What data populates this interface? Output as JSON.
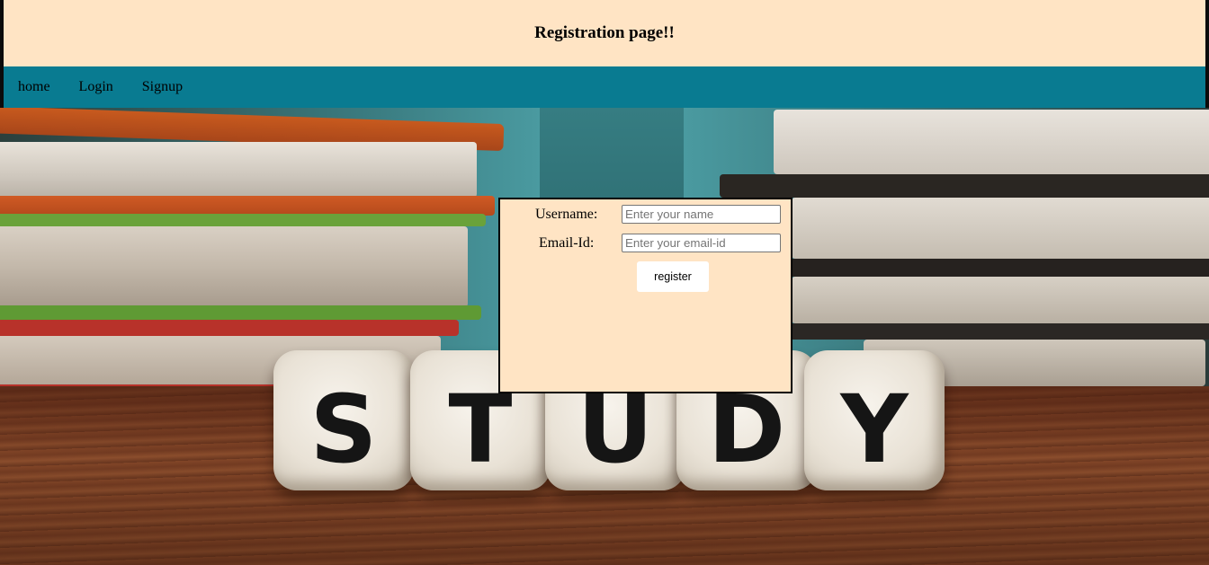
{
  "header": {
    "title": "Registration page!!"
  },
  "nav": {
    "items": [
      {
        "label": "home"
      },
      {
        "label": "Login"
      },
      {
        "label": "Signup"
      }
    ]
  },
  "form": {
    "username_label": "Username:",
    "username_placeholder": "Enter your name",
    "username_value": "",
    "email_label": "Email-Id:",
    "email_placeholder": "Enter your email-id",
    "email_value": "",
    "submit_label": "register"
  },
  "background": {
    "dice_letters": [
      "S",
      "T",
      "U",
      "D",
      "Y"
    ]
  },
  "colors": {
    "header_bg": "#ffe4c4",
    "nav_bg": "#097b91",
    "panel_bg": "#ffe4c4"
  }
}
